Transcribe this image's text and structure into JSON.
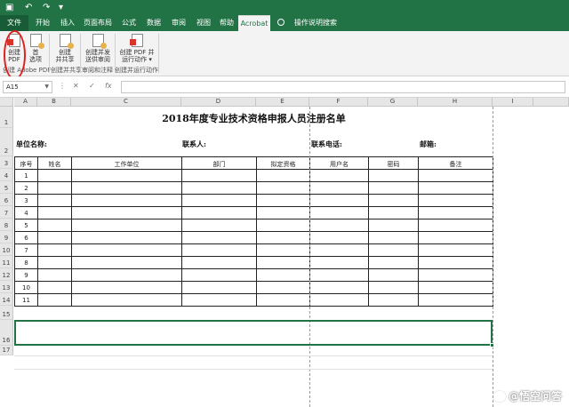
{
  "ribbon_tabs": [
    "文件",
    "开始",
    "插入",
    "页面布局",
    "公式",
    "数据",
    "审阅",
    "视图",
    "帮助",
    "Acrobat"
  ],
  "tell_me": "操作说明搜索",
  "ribbon": {
    "btn_create_pdf": "创建\nPDF",
    "btn_options": "首\n选项",
    "btn_create_share": "创建\n并共享",
    "btn_create_review": "创建并发\n送供审阅",
    "btn_create_run": "创建 PDF 并\n运行动作 ▾",
    "group_create": "创建 Adobe PDF",
    "group_share": "创建并共享",
    "group_review": "审阅和注释",
    "group_run": "创建并运行动作"
  },
  "formula_bar": {
    "name_box": "A15",
    "cancel": "✕",
    "enter": "✓",
    "fx": "fx",
    "value": ""
  },
  "columns": [
    "A",
    "B",
    "C",
    "D",
    "E",
    "F",
    "G",
    "H",
    "I"
  ],
  "rows": [
    "1",
    "2",
    "3",
    "4",
    "5",
    "6",
    "7",
    "8",
    "9",
    "10",
    "11",
    "12",
    "13",
    "14",
    "15",
    "16",
    "17"
  ],
  "sheet": {
    "title": "2018年度专业技术资格申报人员注册名单",
    "unit_label": "单位名称:",
    "contact_label": "联系人:",
    "phone_label": "联系电话:",
    "email_label": "邮箱:",
    "headers": [
      "序号",
      "姓名",
      "工作单位",
      "部门",
      "拟定资格",
      "用户名",
      "密码",
      "备注"
    ],
    "row_numbers": [
      "1",
      "2",
      "3",
      "4",
      "5",
      "6",
      "7",
      "8",
      "9",
      "10",
      "11"
    ]
  },
  "watermark": "@悟空问答"
}
